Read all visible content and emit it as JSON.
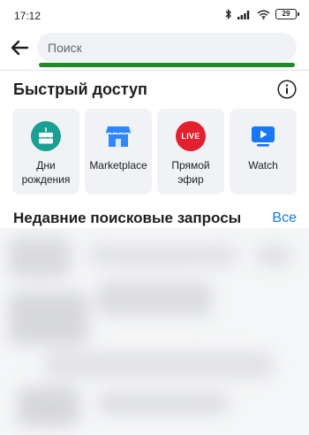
{
  "status_bar": {
    "time": "17:12",
    "battery": "29"
  },
  "search": {
    "placeholder": "Поиск",
    "progress": 1.0
  },
  "quick_access": {
    "title": "Быстрый доступ",
    "tiles": [
      {
        "label": "Дни рождения",
        "icon": "birthday-cake-icon"
      },
      {
        "label": "Marketplace",
        "icon": "marketplace-store-icon"
      },
      {
        "label": "Прямой эфир",
        "icon": "live-icon",
        "badge": "LIVE"
      },
      {
        "label": "Watch",
        "icon": "watch-video-icon"
      }
    ]
  },
  "recent": {
    "title": "Недавние поисковые запросы",
    "see_all": "Все"
  },
  "colors": {
    "accent_blue": "#1877f2",
    "progress_green": "#1f8a2a",
    "birthday_teal": "#1aa093",
    "live_red": "#e4202e",
    "marketplace_blue": "#2d88ff",
    "watch_blue": "#1877f2"
  }
}
